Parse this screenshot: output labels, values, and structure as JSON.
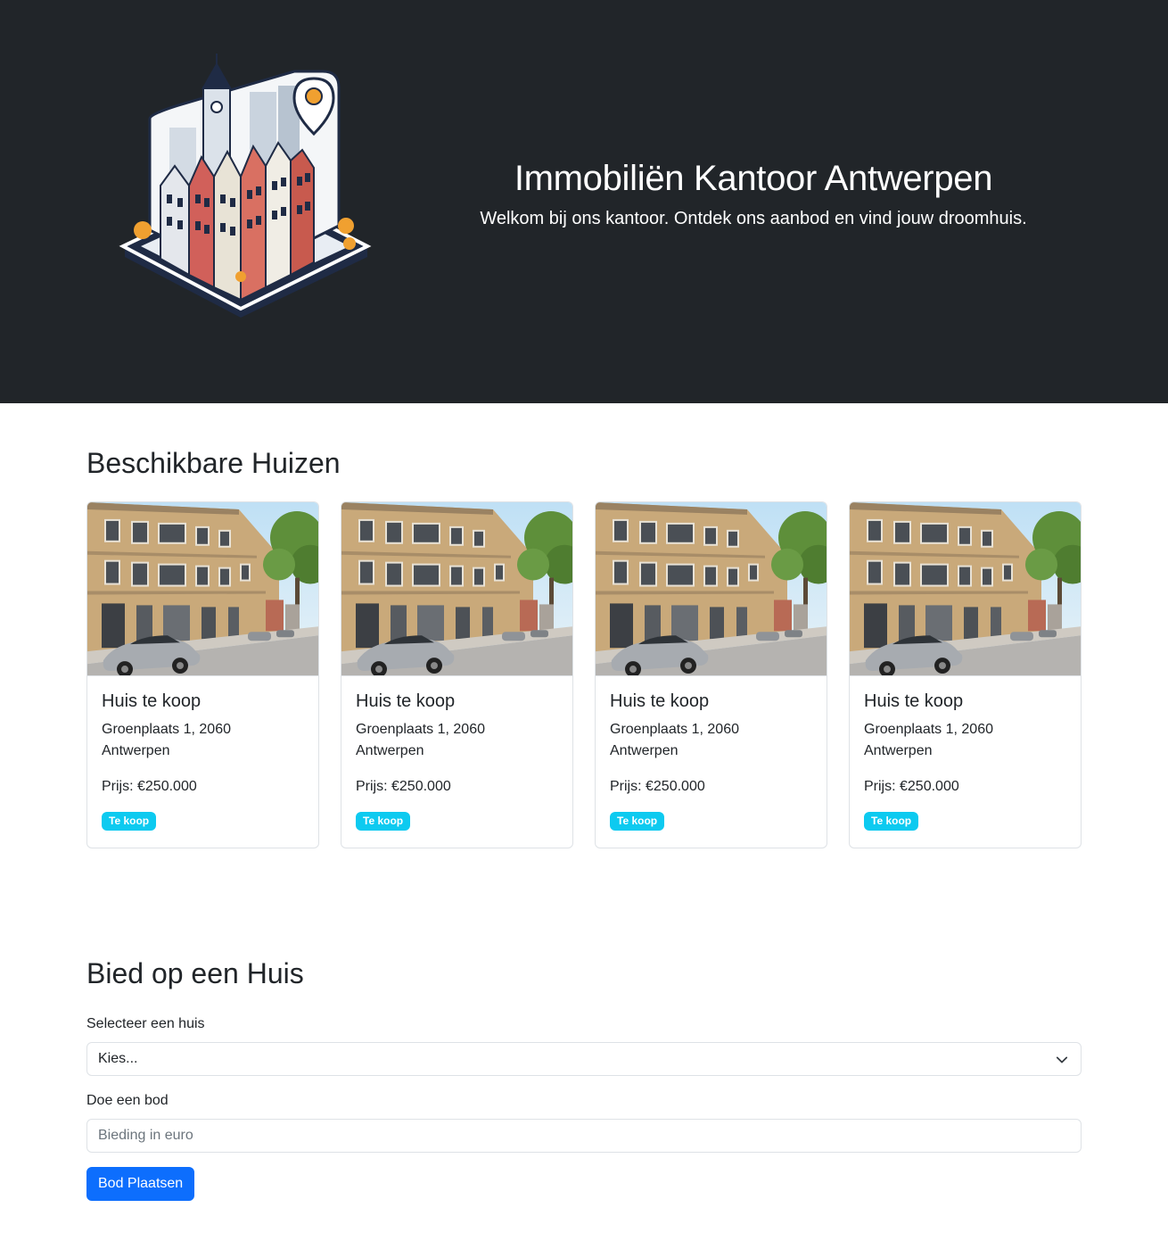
{
  "hero": {
    "title": "Immobiliën Kantoor Antwerpen",
    "subtitle": "Welkom bij ons kantoor. Ontdek ons aanbod en vind jouw droomhuis.",
    "colors": {
      "background": "#212529",
      "text": "#ffffff"
    },
    "logo_icon": "isometric-city-buildings-logo"
  },
  "listings": {
    "title": "Beschikbare Huizen",
    "cards": [
      {
        "title": "Huis te koop",
        "address": "Groenplaats 1, 2060 Antwerpen",
        "price": "Prijs: €250.000",
        "badge": "Te koop",
        "image_icon": "street-house-photo"
      },
      {
        "title": "Huis te koop",
        "address": "Groenplaats 1, 2060 Antwerpen",
        "price": "Prijs: €250.000",
        "badge": "Te koop",
        "image_icon": "street-house-photo"
      },
      {
        "title": "Huis te koop",
        "address": "Groenplaats 1, 2060 Antwerpen",
        "price": "Prijs: €250.000",
        "badge": "Te koop",
        "image_icon": "street-house-photo"
      },
      {
        "title": "Huis te koop",
        "address": "Groenplaats 1, 2060 Antwerpen",
        "price": "Prijs: €250.000",
        "badge": "Te koop",
        "image_icon": "street-house-photo"
      }
    ],
    "badge_color": "#0dcaf0"
  },
  "bid": {
    "title": "Bied op een Huis",
    "select_label": "Selecteer een huis",
    "select_value": "Kies...",
    "amount_label": "Doe een bod",
    "amount_placeholder": "Bieding in euro",
    "submit_label": "Bod Plaatsen",
    "button_color": "#0d6efd"
  }
}
